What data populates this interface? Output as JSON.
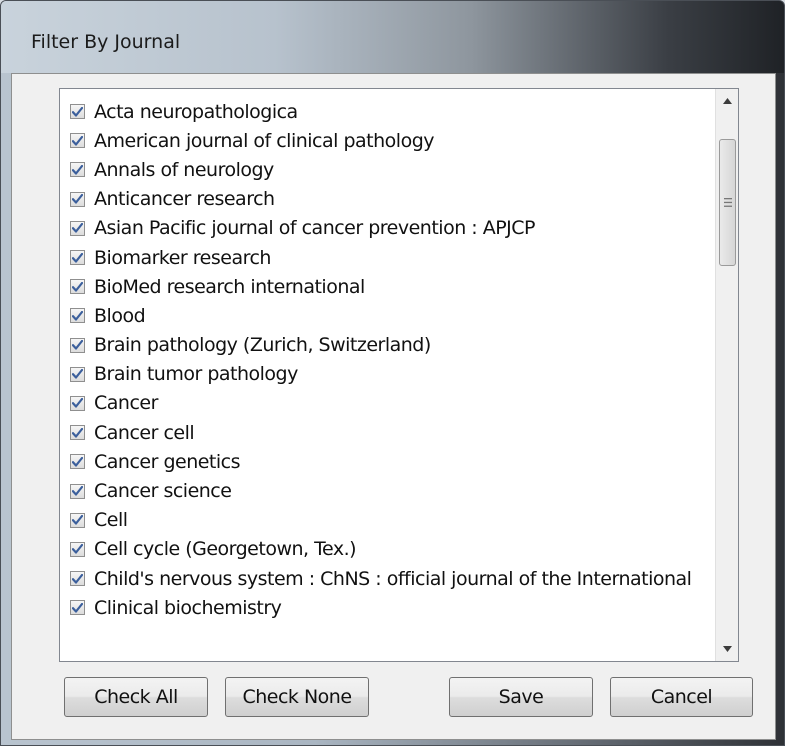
{
  "window": {
    "title": "Filter By Journal"
  },
  "journal_list": {
    "items": [
      {
        "label": "Acta neuropathologica",
        "checked": true
      },
      {
        "label": "American journal of clinical pathology",
        "checked": true
      },
      {
        "label": "Annals of neurology",
        "checked": true
      },
      {
        "label": "Anticancer research",
        "checked": true
      },
      {
        "label": "Asian Pacific journal of cancer prevention : APJCP",
        "checked": true
      },
      {
        "label": "Biomarker research",
        "checked": true
      },
      {
        "label": "BioMed research international",
        "checked": true
      },
      {
        "label": "Blood",
        "checked": true
      },
      {
        "label": "Brain pathology (Zurich, Switzerland)",
        "checked": true
      },
      {
        "label": "Brain tumor pathology",
        "checked": true
      },
      {
        "label": "Cancer",
        "checked": true
      },
      {
        "label": "Cancer cell",
        "checked": true
      },
      {
        "label": "Cancer genetics",
        "checked": true
      },
      {
        "label": "Cancer science",
        "checked": true
      },
      {
        "label": "Cell",
        "checked": true
      },
      {
        "label": "Cell cycle (Georgetown, Tex.)",
        "checked": true
      },
      {
        "label": "Child's nervous system : ChNS : official journal of the International",
        "checked": true
      },
      {
        "label": "Clinical biochemistry",
        "checked": true
      }
    ],
    "scroll_position": 0
  },
  "buttons": {
    "check_all": "Check All",
    "check_none": "Check None",
    "save": "Save",
    "cancel": "Cancel"
  },
  "colors": {
    "checkmark": "#3b5f9c",
    "window_border": "#4a4f56"
  }
}
